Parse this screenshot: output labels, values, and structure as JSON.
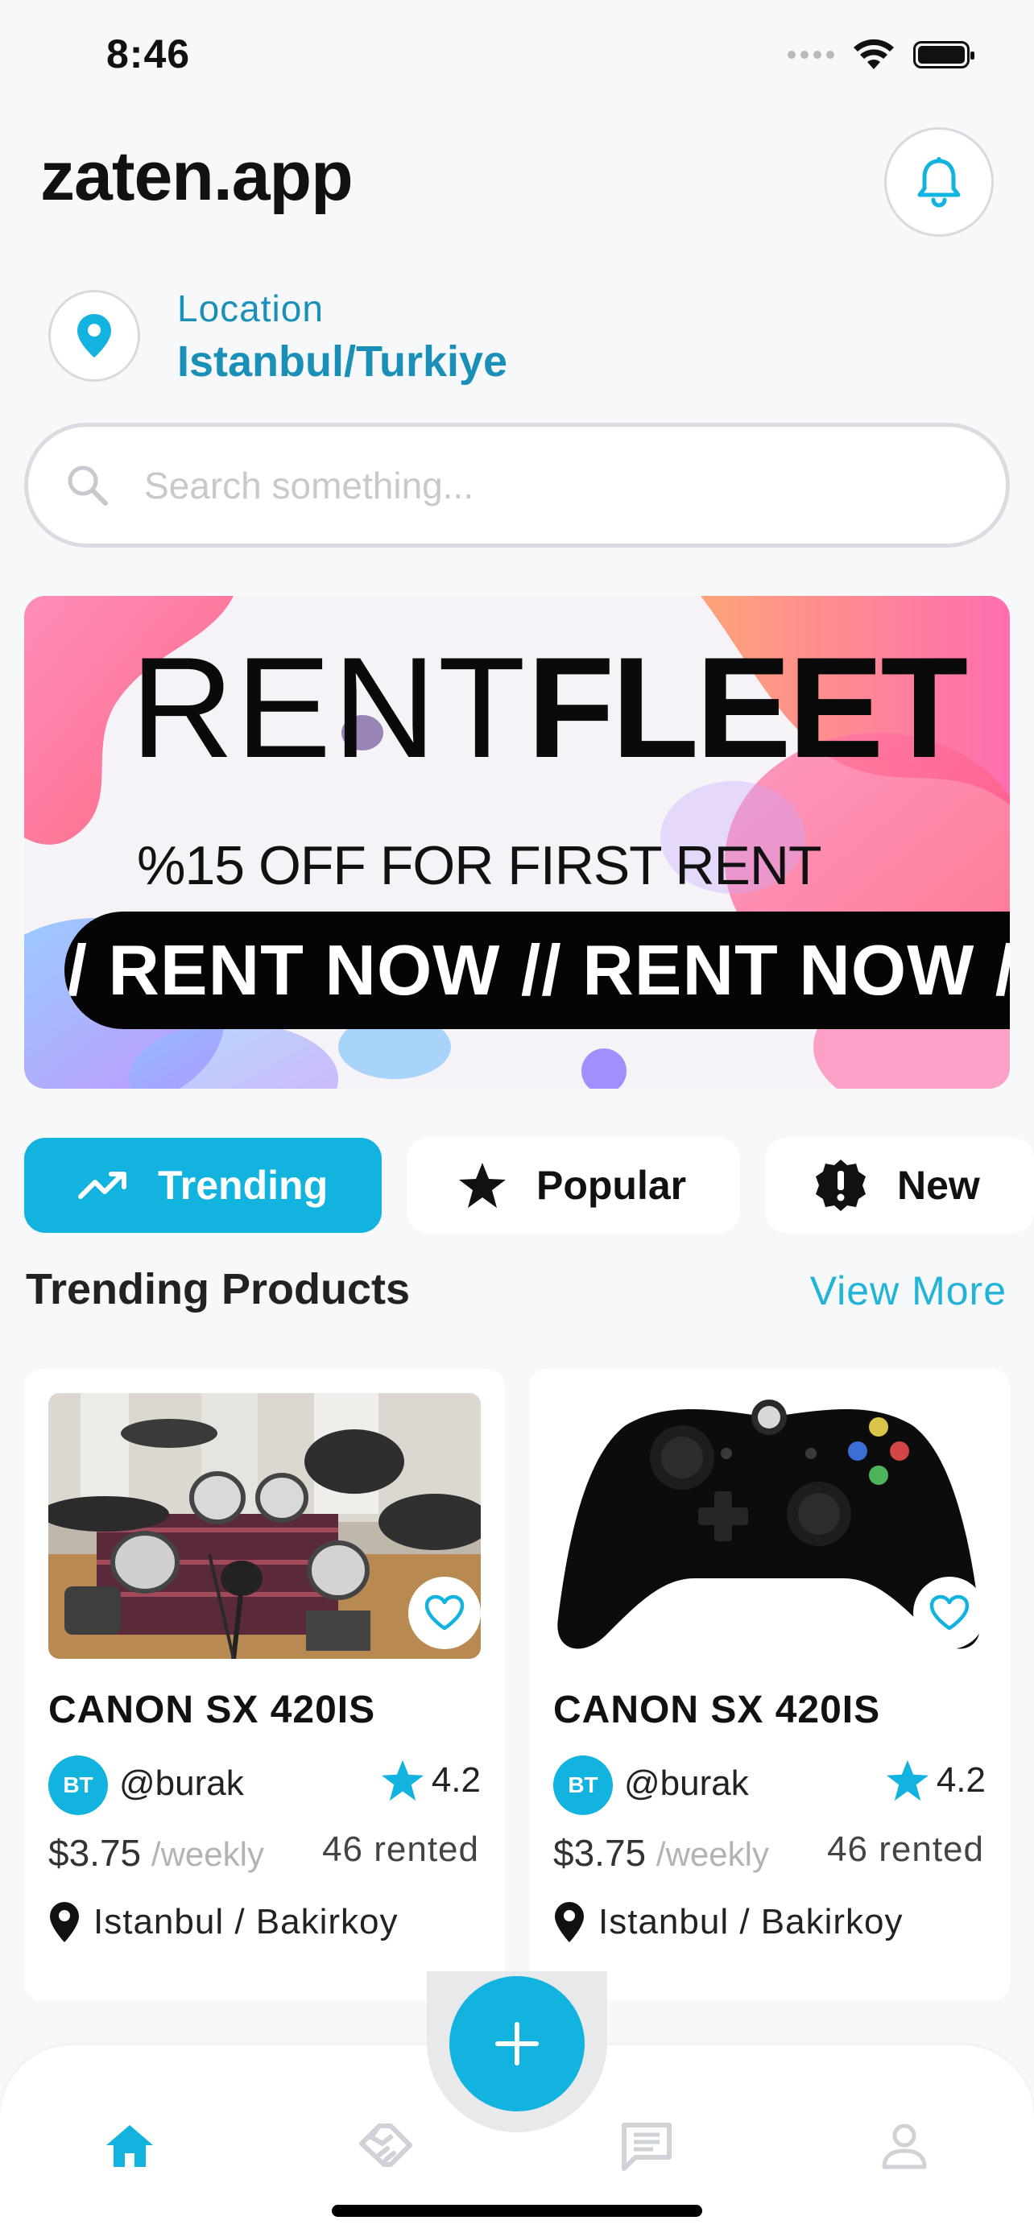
{
  "status_bar": {
    "time": "8:46"
  },
  "header": {
    "title": "zaten.app",
    "notification_icon": "bell-icon"
  },
  "location": {
    "label": "Location",
    "value": "Istanbul/Turkiye",
    "icon": "map-pin-icon"
  },
  "search": {
    "placeholder": "Search something...",
    "value": ""
  },
  "banner": {
    "brand_light": "RENT",
    "brand_bold": "FLEET",
    "offer": "%15 OFF FOR FIRST RENT",
    "strip": "// RENT NOW // RENT NOW //"
  },
  "tabs": [
    {
      "label": "Trending",
      "icon": "trending-up-icon",
      "active": true
    },
    {
      "label": "Popular",
      "icon": "star-icon",
      "active": false
    },
    {
      "label": "New",
      "icon": "alert-badge-icon",
      "active": false
    }
  ],
  "section": {
    "title": "Trending Products",
    "view_more": "View More"
  },
  "products": [
    {
      "name": "CANON SX 420IS",
      "avatar_initials": "BT",
      "user": "@burak",
      "rating": "4.2",
      "price": "$3.75",
      "period": "/weekly",
      "rented": "46 rented",
      "location": "Istanbul / Bakirkoy",
      "image": "electronic-drum-kit"
    },
    {
      "name": "CANON SX 420IS",
      "avatar_initials": "BT",
      "user": "@burak",
      "rating": "4.2",
      "price": "$3.75",
      "period": "/weekly",
      "rented": "46 rented",
      "location": "Istanbul / Bakirkoy",
      "image": "game-controller"
    }
  ],
  "bottom_nav": {
    "items": [
      "home-icon",
      "handshake-icon",
      "chat-icon",
      "profile-icon"
    ],
    "fab_icon": "plus-icon",
    "active_color": "#12b3df",
    "inactive_color": "#cfd2d6"
  },
  "colors": {
    "accent": "#12b3df",
    "location_text": "#1a8fb8"
  }
}
